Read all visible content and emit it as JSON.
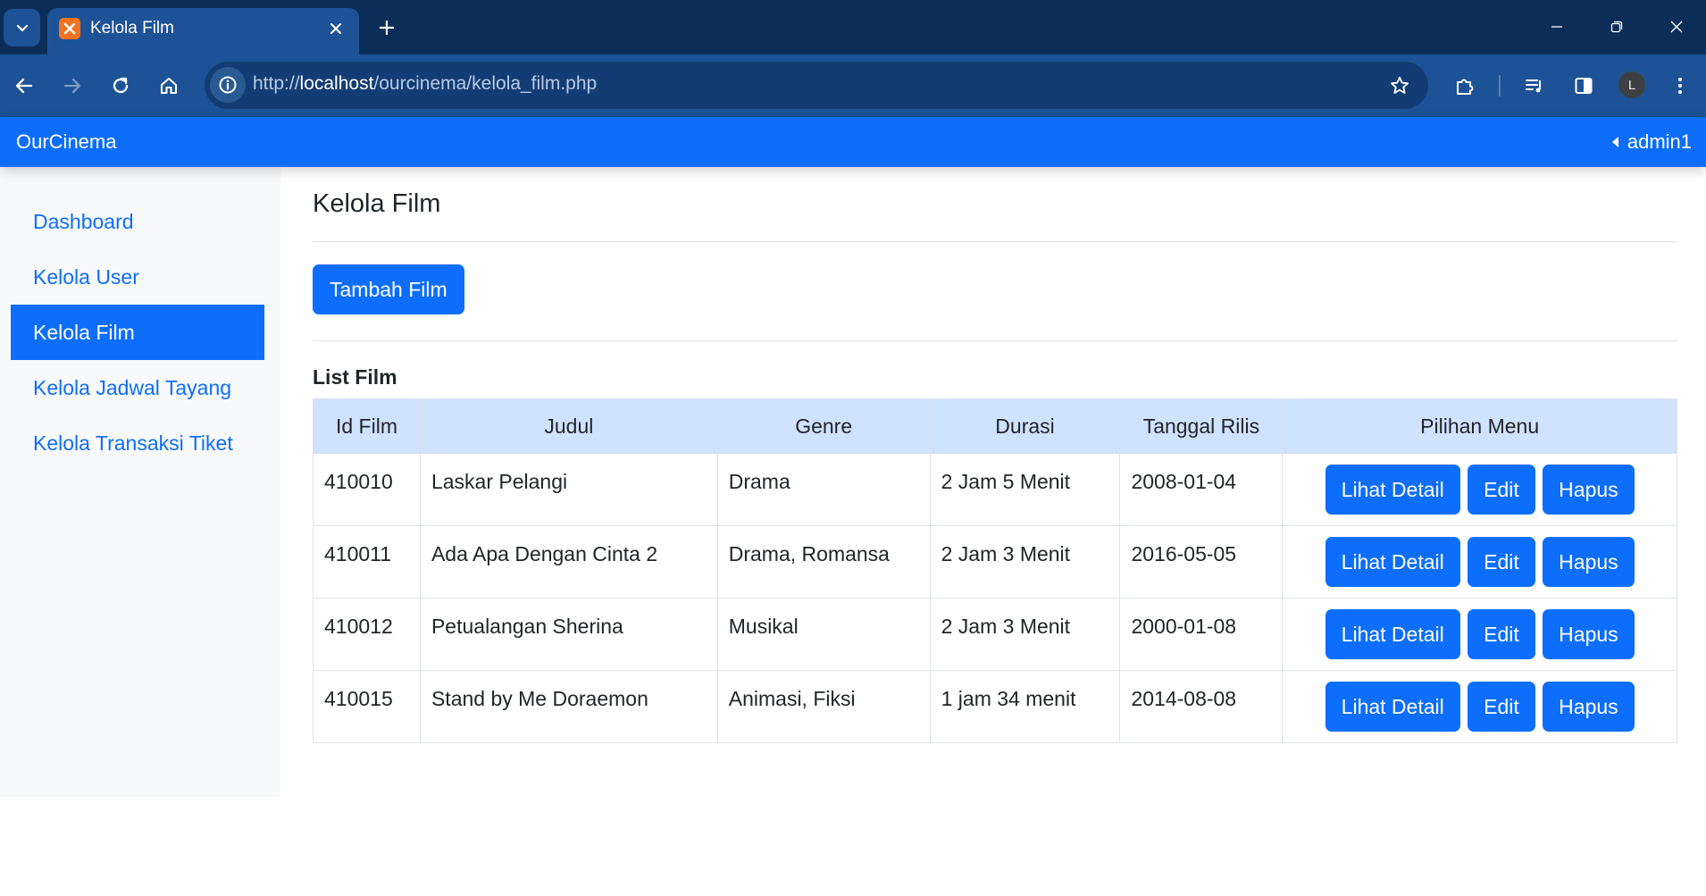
{
  "browser": {
    "tab_title": "Kelola Film",
    "url_scheme": "http://",
    "url_host": "localhost",
    "url_path": "/ourcinema/kelola_film.php",
    "profile_initial": "L"
  },
  "navbar": {
    "brand": "OurCinema",
    "user": "admin1"
  },
  "sidebar": {
    "items": [
      {
        "label": "Dashboard",
        "active": false
      },
      {
        "label": "Kelola User",
        "active": false
      },
      {
        "label": "Kelola Film",
        "active": true
      },
      {
        "label": "Kelola Jadwal Tayang",
        "active": false
      },
      {
        "label": "Kelola Transaksi Tiket",
        "active": false
      }
    ]
  },
  "main": {
    "title": "Kelola Film",
    "add_button": "Tambah Film",
    "list_title": "List Film",
    "table": {
      "headers": [
        "Id Film",
        "Judul",
        "Genre",
        "Durasi",
        "Tanggal Rilis",
        "Pilihan Menu"
      ],
      "rows": [
        {
          "id": "410010",
          "judul": "Laskar Pelangi",
          "genre": "Drama",
          "durasi": "2 Jam 5 Menit",
          "rilis": "2008-01-04"
        },
        {
          "id": "410011",
          "judul": "Ada Apa Dengan Cinta 2",
          "genre": "Drama, Romansa",
          "durasi": "2 Jam 3 Menit",
          "rilis": "2016-05-05"
        },
        {
          "id": "410012",
          "judul": "Petualangan Sherina",
          "genre": "Musikal",
          "durasi": "2 Jam 3 Menit",
          "rilis": "2000-01-08"
        },
        {
          "id": "410015",
          "judul": "Stand by Me Doraemon",
          "genre": "Animasi, Fiksi",
          "durasi": "1 jam 34 menit",
          "rilis": "2014-08-08"
        }
      ],
      "actions": {
        "detail": "Lihat Detail",
        "edit": "Edit",
        "delete": "Hapus"
      }
    }
  },
  "colors": {
    "primary": "#0d6efd",
    "table_header": "#cfe2ff",
    "sidebar_bg": "#f8f9fa",
    "chrome_dark": "#0d2d59",
    "chrome_toolbar": "#1d5396"
  }
}
